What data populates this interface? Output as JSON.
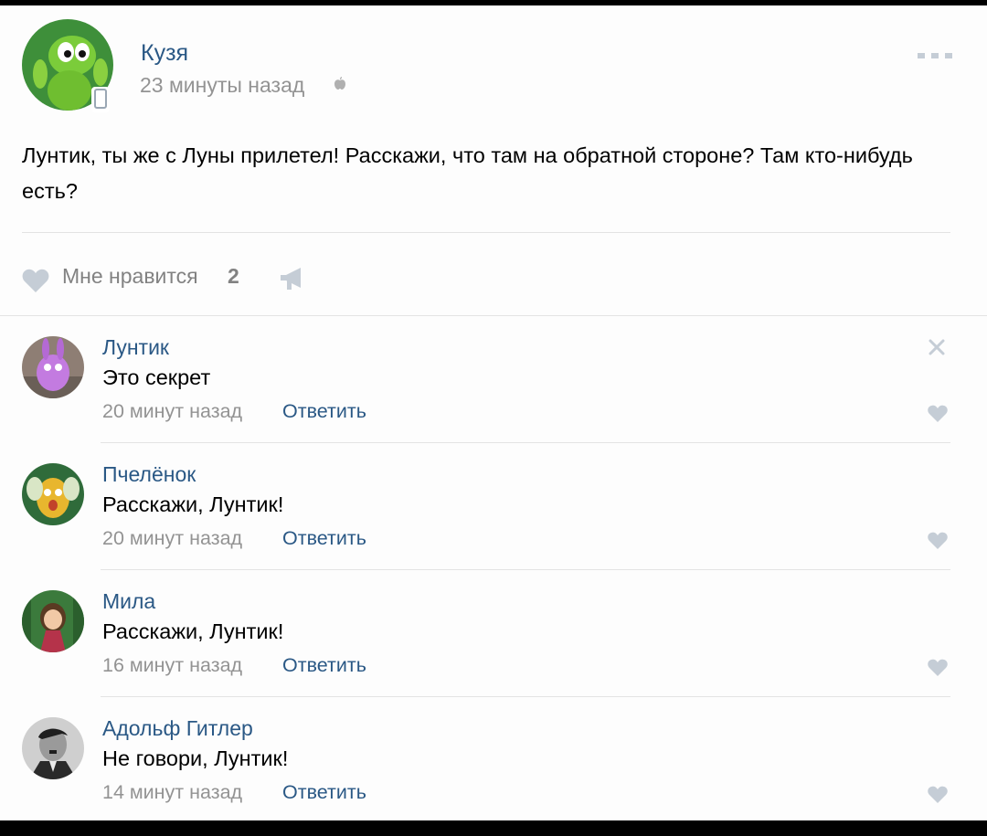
{
  "post": {
    "author": "Кузя",
    "time": "23 минуты назад",
    "text": "Лунтик, ты же с Луны прилетел! Расскажи, что там на обратной стороне? Там кто-нибудь есть?",
    "like_label": "Мне нравится",
    "like_count": "2"
  },
  "comments": [
    {
      "author": "Лунтик",
      "text": "Это секрет",
      "time": "20 минут назад",
      "reply": "Ответить"
    },
    {
      "author": "Пчелёнок",
      "text": "Расскажи, Лунтик!",
      "time": "20 минут назад",
      "reply": "Ответить"
    },
    {
      "author": "Мила",
      "text": "Расскажи, Лунтик!",
      "time": "16 минут назад",
      "reply": "Ответить"
    },
    {
      "author": "Адольф Гитлер",
      "text": "Не говори, Лунтик!",
      "time": "14 минут назад",
      "reply": "Ответить"
    }
  ],
  "colors": {
    "link": "#2a5885",
    "meta": "#939393",
    "icon": "#c5cdd6"
  },
  "icons": [
    "mobile-badge-icon",
    "apple-icon",
    "more-icon",
    "heart-icon",
    "megaphone-icon",
    "close-icon"
  ]
}
